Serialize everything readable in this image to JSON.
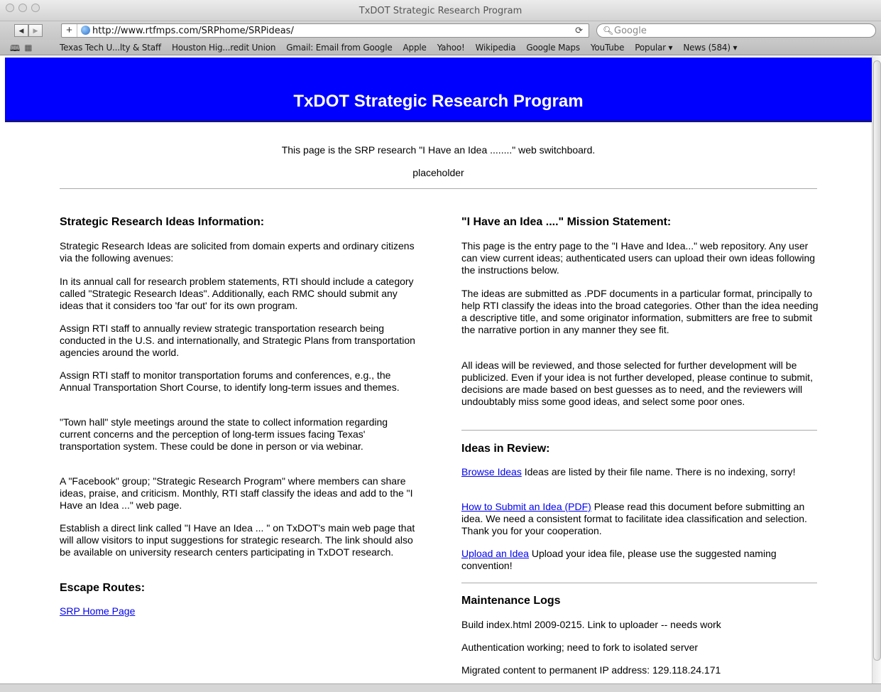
{
  "browser": {
    "window_title": "TxDOT Strategic Research Program",
    "url": "http://www.rtfmps.com/SRPhome/SRPideas/",
    "search_placeholder": "Google",
    "bookmarks": [
      "Texas Tech U...lty & Staff",
      "Houston Hig...redit Union",
      "Gmail: Email from Google",
      "Apple",
      "Yahoo!",
      "Wikipedia",
      "Google Maps",
      "YouTube",
      "Popular ▾",
      "News (584) ▾"
    ]
  },
  "page": {
    "banner_title": "TxDOT Strategic Research Program",
    "banner_color": "#0000ff",
    "intro": "This page is the SRP research \"I Have an Idea ........\" web switchboard.",
    "placeholder": "placeholder",
    "left": {
      "info_heading": "Strategic Research Ideas Information:",
      "paragraphs": [
        "Strategic Research Ideas are solicited from domain experts and ordinary citizens via the following avenues:",
        "In its annual call for research problem statements, RTI should include a category called \"Strategic Research Ideas\". Additionally, each RMC should submit any ideas that it considers too 'far out' for its own program.",
        "Assign RTI staff to annually review strategic transportation research being conducted in the U.S. and internationally, and Strategic Plans from transportation agencies around the world.",
        "Assign RTI staff to monitor transportation forums and conferences, e.g., the Annual Transportation Short Course, to identify long-term issues and themes.",
        "\"Town hall\" style meetings around the state to collect information regarding current concerns and the perception of long-term issues facing Texas' transportation system. These could be done in person or via webinar.",
        "A \"Facebook\" group; \"Strategic Research Program\" where members can share ideas, praise, and criticism. Monthly, RTI staff classify the ideas and add to the \"I Have an Idea ...\" web page.",
        "Establish a direct link called \"I Have an Idea ... \" on TxDOT's main web page that will allow visitors to input suggestions for strategic research. The link should also be available on university research centers participating in TxDOT research."
      ],
      "escape_heading": "Escape Routes:",
      "home_link": "SRP Home Page"
    },
    "right": {
      "mission_heading": "\"I Have an Idea ....\" Mission Statement:",
      "mission_paragraphs": [
        "This page is the entry page to the \"I Have and Idea...\" web repository. Any user can view current ideas; authenticated users can upload their own ideas following the instructions below.",
        "The ideas are submitted as .PDF documents in a particular format, principally to help RTI classify the ideas into the broad categories. Other than the idea needing a descriptive title, and some originator information, submitters are free to submit the narrative portion in any manner they see fit.",
        "All ideas will be reviewed, and those selected for further development will be publicized. Even if your idea is not further developed, please continue to submit, decisions are made based on best guesses as to need, and the reviewers will undoubtably miss some good ideas, and select some poor ones."
      ],
      "review_heading": "Ideas in Review:",
      "review_items": [
        {
          "link": "Browse Ideas",
          "text": " Ideas are listed by their file name. There is no indexing, sorry!"
        },
        {
          "link": "How to Submit an Idea (PDF)",
          "text": " Please read this document before submitting an idea. We need a consistent format to facilitate idea classification and selection. Thank you for your cooperation."
        },
        {
          "link": "Upload an Idea",
          "text": " Upload your idea file, please use the suggested naming convention!"
        }
      ],
      "logs_heading": "Maintenance Logs",
      "logs": [
        "Build index.html 2009-0215. Link to uploader -- needs work",
        "Authentication working; need to fork to isolated server",
        "Migrated content to permanent IP address: 129.118.24.171"
      ]
    }
  }
}
